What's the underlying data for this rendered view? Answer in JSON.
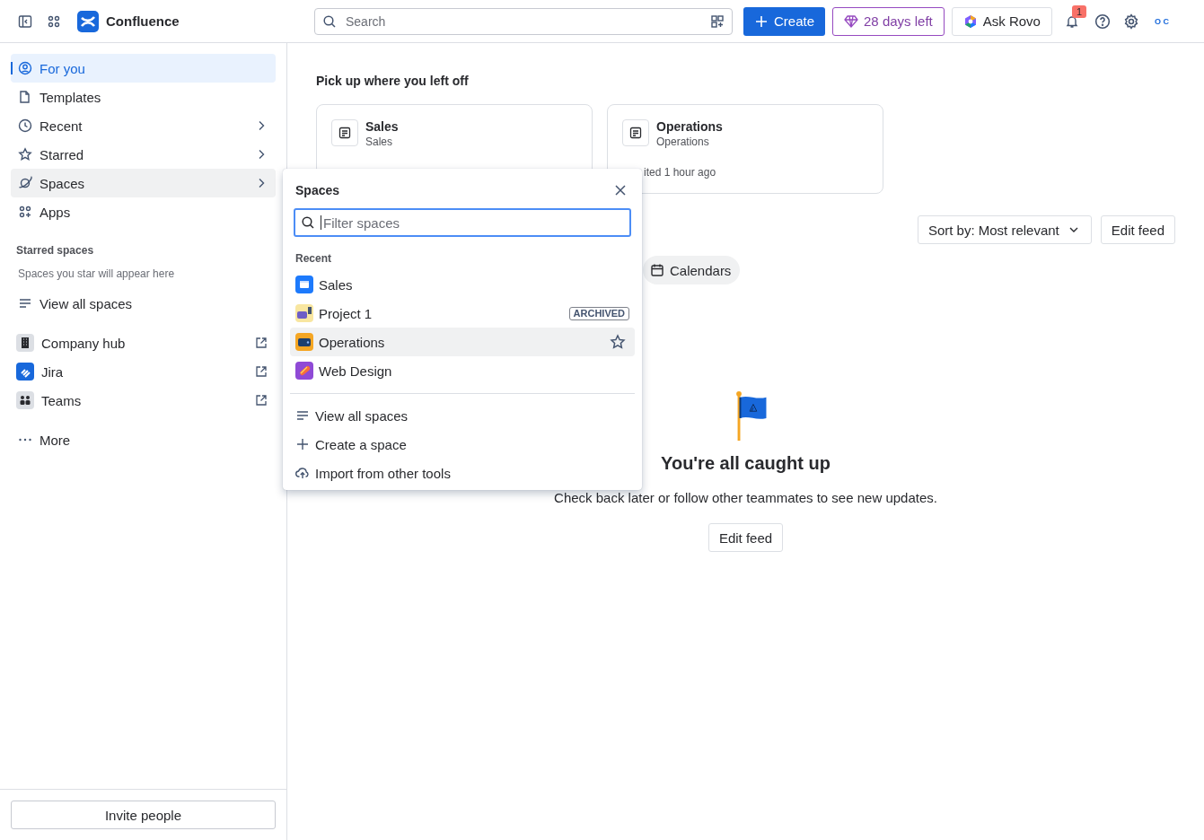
{
  "topbar": {
    "product": "Confluence",
    "search": {
      "placeholder": "Search"
    },
    "create": "Create",
    "trial": "28 days left",
    "ask": "Ask Rovo",
    "notifications": "1",
    "avatar": "O C"
  },
  "sidebar": {
    "items": [
      {
        "label": "For you",
        "chevron": false,
        "selected": true,
        "hovered": false
      },
      {
        "label": "Templates",
        "chevron": false,
        "selected": false,
        "hovered": false
      },
      {
        "label": "Recent",
        "chevron": true,
        "selected": false,
        "hovered": false
      },
      {
        "label": "Starred",
        "chevron": true,
        "selected": false,
        "hovered": false
      },
      {
        "label": "Spaces",
        "chevron": true,
        "selected": false,
        "hovered": true
      },
      {
        "label": "Apps",
        "chevron": false,
        "selected": false,
        "hovered": false
      }
    ],
    "starred_heading": "Starred spaces",
    "starred_empty": "Spaces you star will appear here",
    "view_all": "View all spaces",
    "links": [
      {
        "label": "Company hub"
      },
      {
        "label": "Jira"
      },
      {
        "label": "Teams"
      }
    ],
    "more": "More",
    "invite": "Invite people"
  },
  "main": {
    "heading": "Pick up where you left off",
    "cards": [
      {
        "title": "Sales",
        "subtitle": "Sales"
      },
      {
        "title": "Operations",
        "subtitle": "Operations",
        "meta": "ited 1 hour ago"
      }
    ],
    "sort": "Sort by: Most relevant",
    "edit_feed_top": "Edit feed",
    "chip": "Calendars",
    "empty": {
      "title": "You're all caught up",
      "text": "Check back later or follow other teammates to see new updates.",
      "button": "Edit feed"
    }
  },
  "popover": {
    "title": "Spaces",
    "filter": {
      "placeholder": "Filter spaces"
    },
    "recent_heading": "Recent",
    "spaces": [
      {
        "name": "Sales",
        "archived": false,
        "hovered": false
      },
      {
        "name": "Project 1",
        "archived": true,
        "badge": "ARCHIVED",
        "hovered": false
      },
      {
        "name": "Operations",
        "archived": false,
        "hovered": true
      },
      {
        "name": "Web Design",
        "archived": false,
        "hovered": false
      }
    ],
    "actions": [
      {
        "label": "View all spaces"
      },
      {
        "label": "Create a space"
      },
      {
        "label": "Import from other tools"
      }
    ]
  }
}
